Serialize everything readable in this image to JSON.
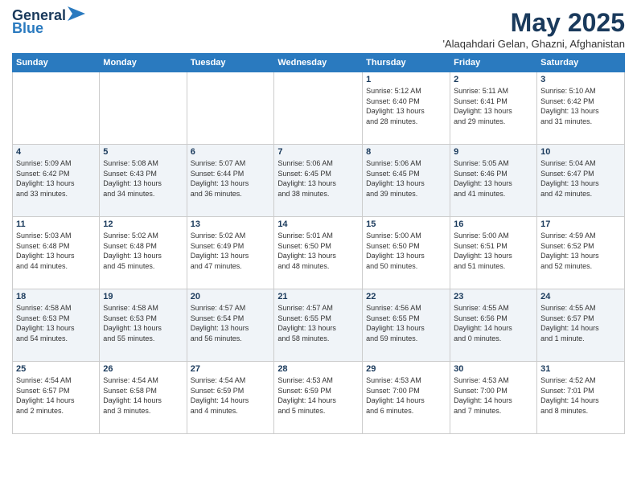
{
  "logo": {
    "line1": "General",
    "line2": "Blue"
  },
  "header": {
    "month": "May 2025",
    "location": "'Alaqahdari Gelan, Ghazni, Afghanistan"
  },
  "days_of_week": [
    "Sunday",
    "Monday",
    "Tuesday",
    "Wednesday",
    "Thursday",
    "Friday",
    "Saturday"
  ],
  "weeks": [
    [
      {
        "num": "",
        "info": ""
      },
      {
        "num": "",
        "info": ""
      },
      {
        "num": "",
        "info": ""
      },
      {
        "num": "",
        "info": ""
      },
      {
        "num": "1",
        "info": "Sunrise: 5:12 AM\nSunset: 6:40 PM\nDaylight: 13 hours\nand 28 minutes."
      },
      {
        "num": "2",
        "info": "Sunrise: 5:11 AM\nSunset: 6:41 PM\nDaylight: 13 hours\nand 29 minutes."
      },
      {
        "num": "3",
        "info": "Sunrise: 5:10 AM\nSunset: 6:42 PM\nDaylight: 13 hours\nand 31 minutes."
      }
    ],
    [
      {
        "num": "4",
        "info": "Sunrise: 5:09 AM\nSunset: 6:42 PM\nDaylight: 13 hours\nand 33 minutes."
      },
      {
        "num": "5",
        "info": "Sunrise: 5:08 AM\nSunset: 6:43 PM\nDaylight: 13 hours\nand 34 minutes."
      },
      {
        "num": "6",
        "info": "Sunrise: 5:07 AM\nSunset: 6:44 PM\nDaylight: 13 hours\nand 36 minutes."
      },
      {
        "num": "7",
        "info": "Sunrise: 5:06 AM\nSunset: 6:45 PM\nDaylight: 13 hours\nand 38 minutes."
      },
      {
        "num": "8",
        "info": "Sunrise: 5:06 AM\nSunset: 6:45 PM\nDaylight: 13 hours\nand 39 minutes."
      },
      {
        "num": "9",
        "info": "Sunrise: 5:05 AM\nSunset: 6:46 PM\nDaylight: 13 hours\nand 41 minutes."
      },
      {
        "num": "10",
        "info": "Sunrise: 5:04 AM\nSunset: 6:47 PM\nDaylight: 13 hours\nand 42 minutes."
      }
    ],
    [
      {
        "num": "11",
        "info": "Sunrise: 5:03 AM\nSunset: 6:48 PM\nDaylight: 13 hours\nand 44 minutes."
      },
      {
        "num": "12",
        "info": "Sunrise: 5:02 AM\nSunset: 6:48 PM\nDaylight: 13 hours\nand 45 minutes."
      },
      {
        "num": "13",
        "info": "Sunrise: 5:02 AM\nSunset: 6:49 PM\nDaylight: 13 hours\nand 47 minutes."
      },
      {
        "num": "14",
        "info": "Sunrise: 5:01 AM\nSunset: 6:50 PM\nDaylight: 13 hours\nand 48 minutes."
      },
      {
        "num": "15",
        "info": "Sunrise: 5:00 AM\nSunset: 6:50 PM\nDaylight: 13 hours\nand 50 minutes."
      },
      {
        "num": "16",
        "info": "Sunrise: 5:00 AM\nSunset: 6:51 PM\nDaylight: 13 hours\nand 51 minutes."
      },
      {
        "num": "17",
        "info": "Sunrise: 4:59 AM\nSunset: 6:52 PM\nDaylight: 13 hours\nand 52 minutes."
      }
    ],
    [
      {
        "num": "18",
        "info": "Sunrise: 4:58 AM\nSunset: 6:53 PM\nDaylight: 13 hours\nand 54 minutes."
      },
      {
        "num": "19",
        "info": "Sunrise: 4:58 AM\nSunset: 6:53 PM\nDaylight: 13 hours\nand 55 minutes."
      },
      {
        "num": "20",
        "info": "Sunrise: 4:57 AM\nSunset: 6:54 PM\nDaylight: 13 hours\nand 56 minutes."
      },
      {
        "num": "21",
        "info": "Sunrise: 4:57 AM\nSunset: 6:55 PM\nDaylight: 13 hours\nand 58 minutes."
      },
      {
        "num": "22",
        "info": "Sunrise: 4:56 AM\nSunset: 6:55 PM\nDaylight: 13 hours\nand 59 minutes."
      },
      {
        "num": "23",
        "info": "Sunrise: 4:55 AM\nSunset: 6:56 PM\nDaylight: 14 hours\nand 0 minutes."
      },
      {
        "num": "24",
        "info": "Sunrise: 4:55 AM\nSunset: 6:57 PM\nDaylight: 14 hours\nand 1 minute."
      }
    ],
    [
      {
        "num": "25",
        "info": "Sunrise: 4:54 AM\nSunset: 6:57 PM\nDaylight: 14 hours\nand 2 minutes."
      },
      {
        "num": "26",
        "info": "Sunrise: 4:54 AM\nSunset: 6:58 PM\nDaylight: 14 hours\nand 3 minutes."
      },
      {
        "num": "27",
        "info": "Sunrise: 4:54 AM\nSunset: 6:59 PM\nDaylight: 14 hours\nand 4 minutes."
      },
      {
        "num": "28",
        "info": "Sunrise: 4:53 AM\nSunset: 6:59 PM\nDaylight: 14 hours\nand 5 minutes."
      },
      {
        "num": "29",
        "info": "Sunrise: 4:53 AM\nSunset: 7:00 PM\nDaylight: 14 hours\nand 6 minutes."
      },
      {
        "num": "30",
        "info": "Sunrise: 4:53 AM\nSunset: 7:00 PM\nDaylight: 14 hours\nand 7 minutes."
      },
      {
        "num": "31",
        "info": "Sunrise: 4:52 AM\nSunset: 7:01 PM\nDaylight: 14 hours\nand 8 minutes."
      }
    ]
  ]
}
